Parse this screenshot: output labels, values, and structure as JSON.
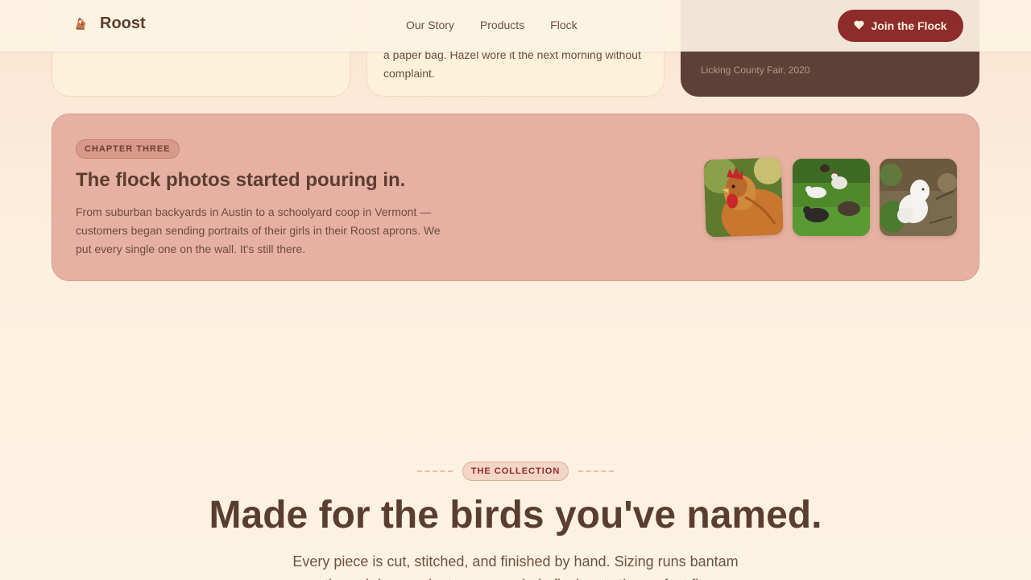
{
  "header": {
    "brand": "Roost",
    "nav": [
      "Our Story",
      "Products",
      "Flock"
    ],
    "cta_label": "Join the Flock",
    "icons": {
      "logo": "rooster-logo-icon",
      "cta": "heart-icon"
    }
  },
  "story_cards": {
    "card_b_text": "a paper bag. Hazel wore it the next morning without complaint.",
    "card_c_caption": "Licking County Fair, 2020"
  },
  "chapter": {
    "badge": "CHAPTER THREE",
    "title": "The flock photos started pouring in.",
    "text": "From suburban backyards in Austin to a schoolyard coop in Vermont — customers began sending portraits of their girls in their Roost aprons. We put every single one on the wall. It's still there.",
    "photos": [
      "orange-hen-photo",
      "flock-on-grass-photo",
      "white-silkie-photo"
    ]
  },
  "collection": {
    "eyebrow": "THE COLLECTION",
    "headline": "Made for the birds you've named.",
    "subtext": "Every piece is cut, stitched, and finished by hand. Sizing runs bantam through jersey giant, so your whole flock gets the perfect fit."
  },
  "colors": {
    "accent": "#8e2b2b",
    "brown": "#5a3d31",
    "cream": "#fdf3e2",
    "chapter_bg": "#e6b1a2"
  }
}
